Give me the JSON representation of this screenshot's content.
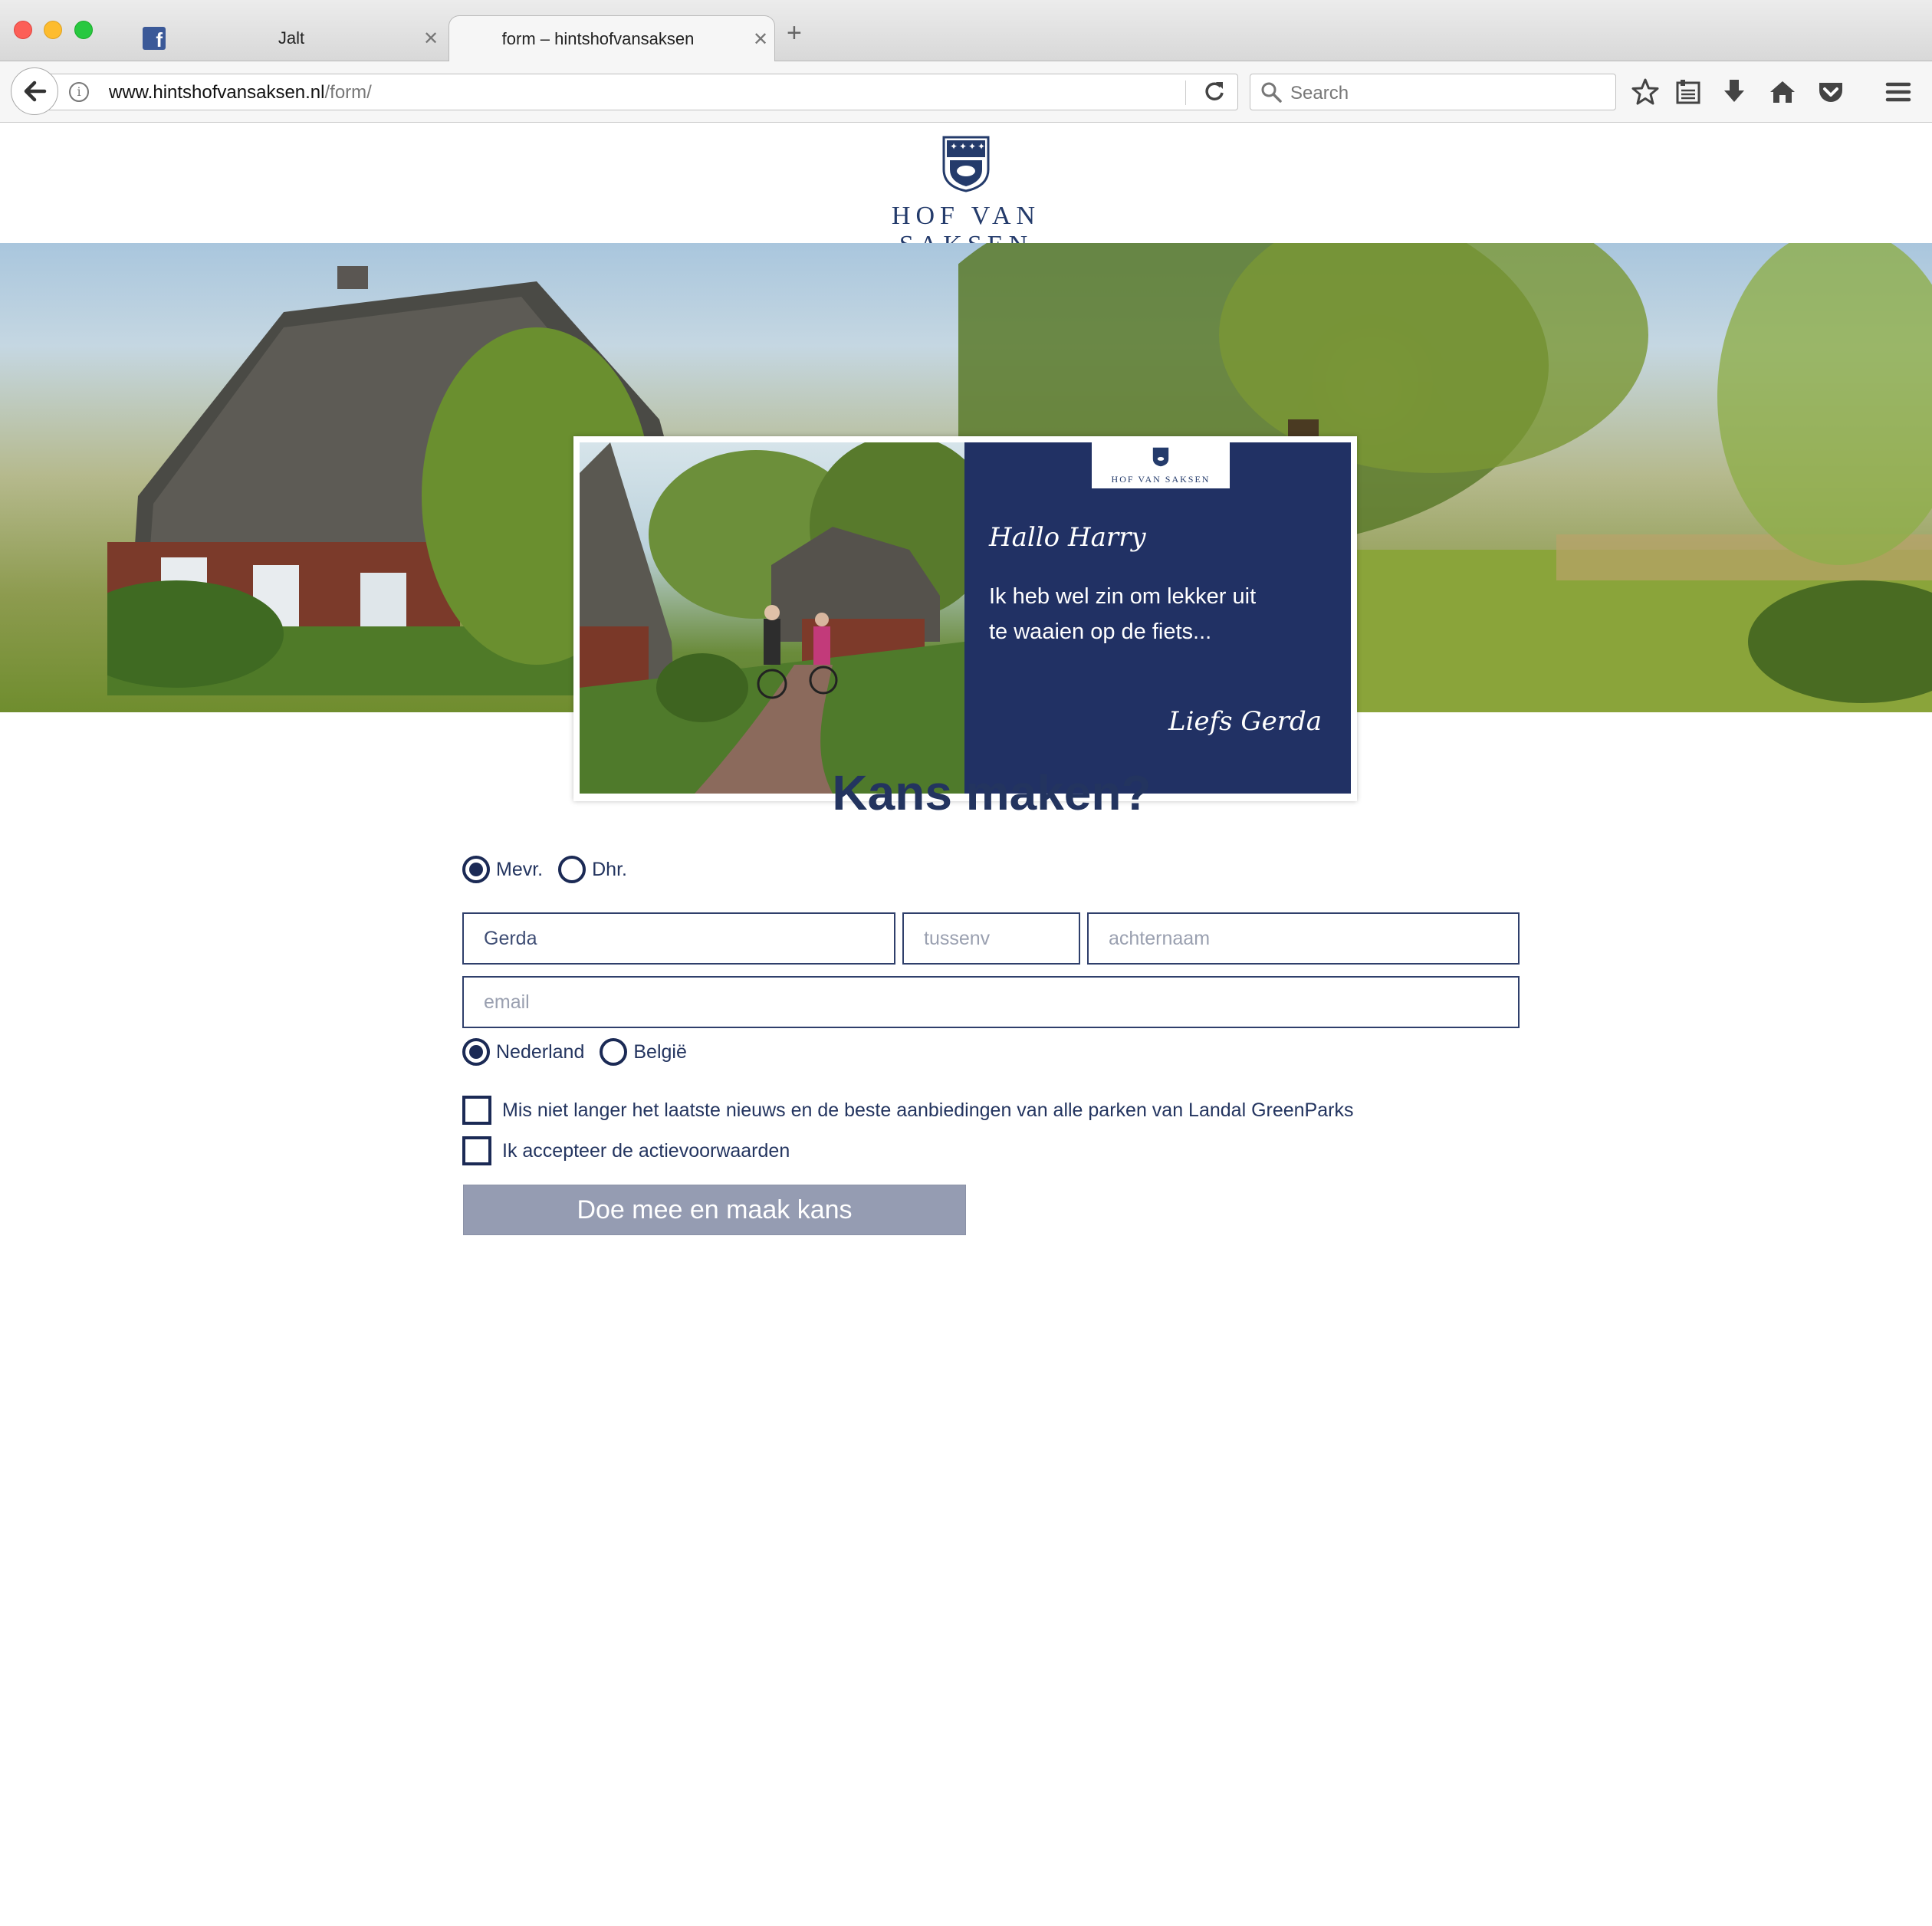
{
  "browser": {
    "tabs": [
      {
        "label": "Jalt",
        "icon": "facebook-icon"
      },
      {
        "label": "form – hintshofvansaksen",
        "icon": ""
      }
    ],
    "url_domain": "www.hintshofvansaksen.nl",
    "url_path": "/form/",
    "search_placeholder": "Search"
  },
  "header": {
    "logo_text": "HOF VAN SAKSEN"
  },
  "hero_card": {
    "logo_text": "HOF VAN SAKSEN",
    "greeting": "Hallo Harry",
    "message_line1": "Ik heb wel zin om lekker uit",
    "message_line2": "te waaien op de fiets...",
    "signoff": "Liefs Gerda"
  },
  "form": {
    "title": "Kans maken?",
    "salutation": {
      "options": [
        "Mevr.",
        "Dhr."
      ],
      "selected": "Mevr."
    },
    "first_name": {
      "value": "Gerda",
      "placeholder": ""
    },
    "middle_name": {
      "value": "",
      "placeholder": "tussenv"
    },
    "last_name": {
      "value": "",
      "placeholder": "achternaam"
    },
    "email": {
      "value": "",
      "placeholder": "email"
    },
    "country": {
      "options": [
        "Nederland",
        "België"
      ],
      "selected": "Nederland"
    },
    "newsletter_label": "Mis niet langer het laatste nieuws en de beste aanbiedingen van alle parken van Landal GreenParks",
    "newsletter_checked": false,
    "terms_label": "Ik accepteer de actievoorwaarden",
    "terms_checked": false,
    "submit_label": "Doe mee en maak kans"
  },
  "colors": {
    "brand_navy": "#213164",
    "text_navy": "#23345f",
    "button_disabled": "#959cb2"
  }
}
